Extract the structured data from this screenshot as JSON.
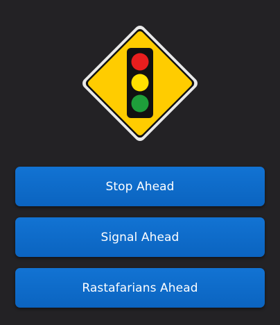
{
  "question": {
    "sign_icon": "traffic-signal-ahead-sign",
    "sign_color": "#FFCC00",
    "light_colors": {
      "red": "#E81E1E",
      "yellow": "#FFE100",
      "green": "#1E9E3A"
    }
  },
  "answers": [
    {
      "label": "Stop Ahead"
    },
    {
      "label": "Signal Ahead"
    },
    {
      "label": "Rastafarians Ahead"
    }
  ],
  "theme": {
    "background": "#232225",
    "button_color": "#0B6BCB",
    "button_text": "#FFFFFF"
  }
}
